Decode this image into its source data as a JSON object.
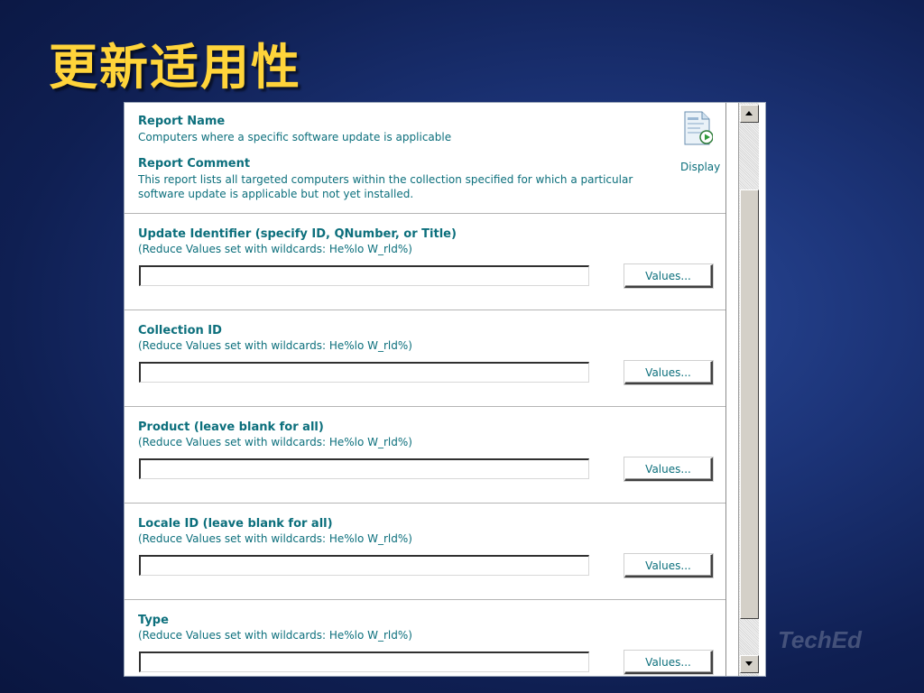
{
  "slide": {
    "title": "更新适用性"
  },
  "report": {
    "name_label": "Report Name",
    "name_value": "Computers where a specific software update is applicable",
    "comment_label": "Report Comment",
    "comment_value": "This report lists all targeted computers within the collection specified for which a particular software update is applicable but not yet installed.",
    "display_label": "Display",
    "display_icon": "report-display-icon"
  },
  "parameters": [
    {
      "name": "Update Identifier (specify ID, QNumber, or Title)",
      "hint": "(Reduce Values set with wildcards: He%lo W_rld%)",
      "value": "",
      "button": "Values..."
    },
    {
      "name": "Collection ID",
      "hint": "(Reduce Values set with wildcards: He%lo W_rld%)",
      "value": "",
      "button": "Values..."
    },
    {
      "name": "Product (leave blank for all)",
      "hint": "(Reduce Values set with wildcards: He%lo W_rld%)",
      "value": "",
      "button": "Values..."
    },
    {
      "name": "Locale ID (leave blank for all)",
      "hint": "(Reduce Values set with wildcards: He%lo W_rld%)",
      "value": "",
      "button": "Values..."
    },
    {
      "name": "Type",
      "hint": "(Reduce Values set with wildcards: He%lo W_rld%)",
      "value": "",
      "button": "Values..."
    }
  ],
  "watermark": {
    "text": "TechEd"
  },
  "colors": {
    "label": "#0c6f7c",
    "title": "#ffd43a",
    "background": "#1c3478"
  }
}
